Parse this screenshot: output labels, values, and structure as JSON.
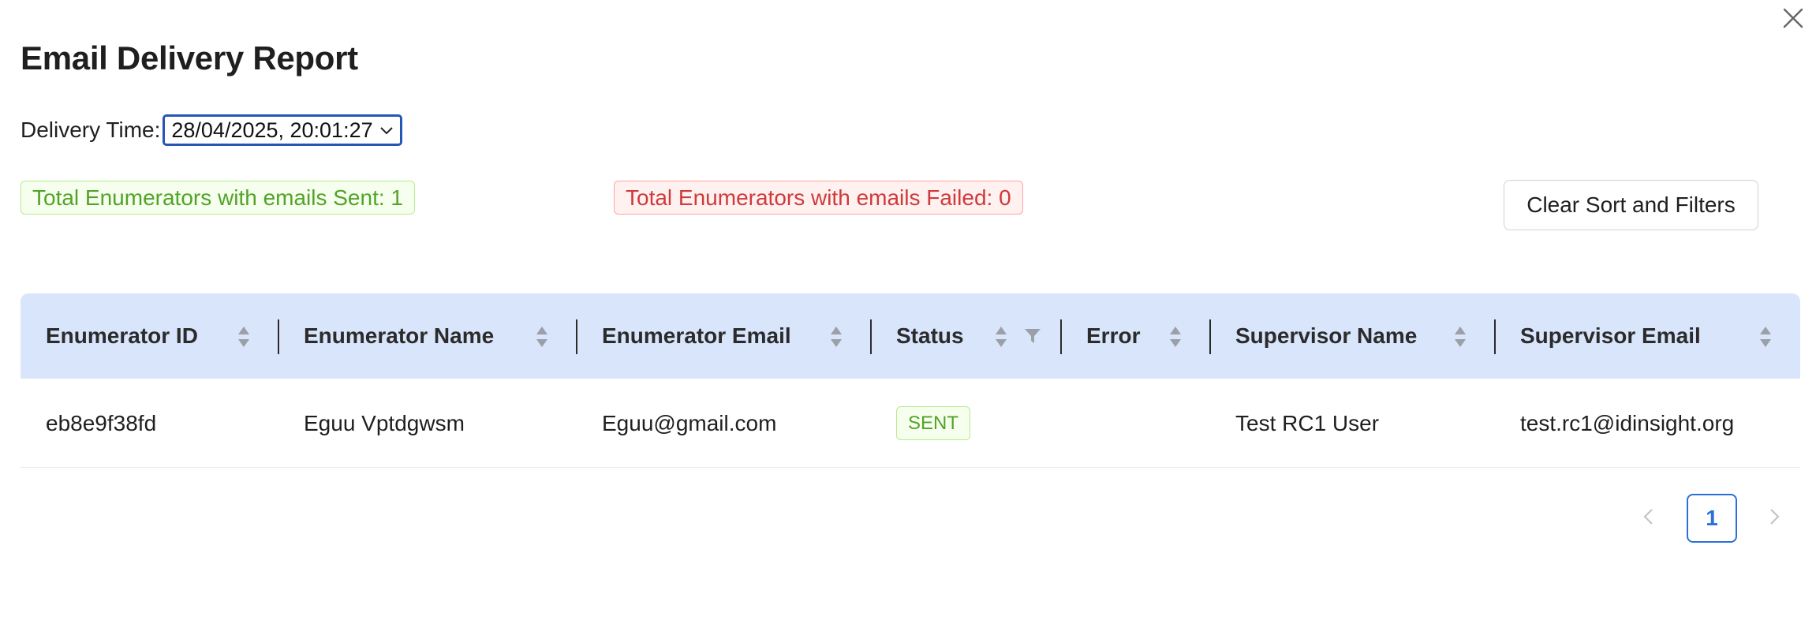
{
  "modal": {
    "title": "Email Delivery Report"
  },
  "delivery": {
    "label": "Delivery Time:",
    "selected": "28/04/2025, 20:01:27"
  },
  "summary": {
    "sent": "Total Enumerators with emails Sent: 1",
    "failed": "Total Enumerators with emails Failed: 0"
  },
  "actions": {
    "clear": "Clear Sort and Filters"
  },
  "table": {
    "columns": [
      "Enumerator ID",
      "Enumerator Name",
      "Enumerator Email",
      "Status",
      "Error",
      "Supervisor Name",
      "Supervisor Email"
    ],
    "rows": [
      {
        "enumerator_id": "eb8e9f38fd",
        "enumerator_name": "Eguu Vptdgwsm",
        "enumerator_email": "Eguu@gmail.com",
        "status": "SENT",
        "error": "",
        "supervisor_name": "Test RC1 User",
        "supervisor_email": "test.rc1@idinsight.org"
      }
    ]
  },
  "pagination": {
    "current_page": "1"
  },
  "colors": {
    "header_bg": "#d9e5fb",
    "success": "#52a32a",
    "danger": "#cf3a3a",
    "primary": "#2a6fdc"
  },
  "icons": {
    "close": "close-icon",
    "select": "chevron-down-icon",
    "sort": "sort-icon",
    "filter": "filter-icon",
    "prev": "chevron-left-icon",
    "next": "chevron-right-icon"
  }
}
